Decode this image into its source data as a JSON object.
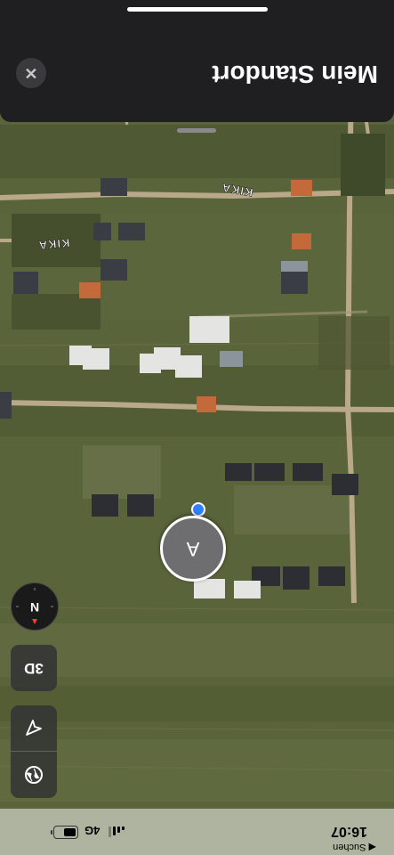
{
  "status_bar": {
    "time": "16:07",
    "back_app": "◀ Suchen",
    "network": "4G",
    "signal_bars": 3
  },
  "map": {
    "road_labels": [
      "KIKA",
      "KIKA"
    ],
    "location_pin_letter": "A",
    "compass_label": "N",
    "view_mode_label": "3D",
    "colors": {
      "user_dot": "#2f80ff",
      "grass": "#59633a",
      "road": "#b9a98a"
    }
  },
  "controls": {
    "globe_icon": "globe-icon",
    "location_icon": "location-arrow-icon"
  },
  "sheet": {
    "title": "Mein Standort",
    "close_icon": "close-icon"
  }
}
